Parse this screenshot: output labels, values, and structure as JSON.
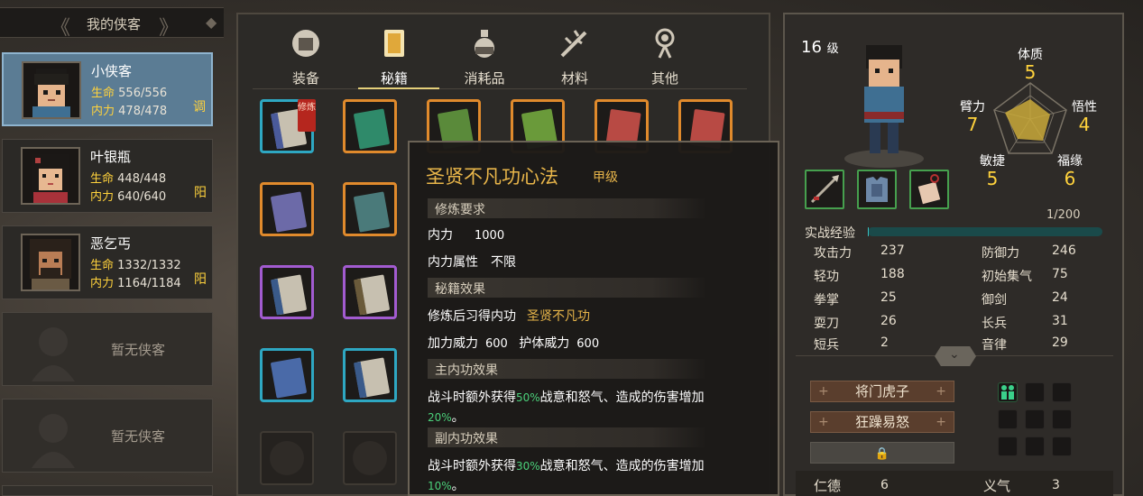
{
  "roster": {
    "title": "我的侠客",
    "characters": [
      {
        "name": "小侠客",
        "hp_label": "生命",
        "hp": "556/556",
        "mp_label": "内力",
        "mp": "478/478",
        "tag": "调"
      },
      {
        "name": "叶银瓶",
        "hp_label": "生命",
        "hp": "448/448",
        "mp_label": "内力",
        "mp": "640/640",
        "tag": "阳"
      },
      {
        "name": "恶乞丐",
        "hp_label": "生命",
        "hp": "1332/1332",
        "mp_label": "内力",
        "mp": "1164/1184",
        "tag": "阳"
      }
    ],
    "empty_slots": [
      "暂无侠客",
      "暂无侠客"
    ]
  },
  "tabs": [
    {
      "label": "装备",
      "icon": "armor-icon"
    },
    {
      "label": "秘籍",
      "icon": "book-icon"
    },
    {
      "label": "消耗品",
      "icon": "potion-icon"
    },
    {
      "label": "材料",
      "icon": "herb-icon"
    },
    {
      "label": "其他",
      "icon": "amulet-icon"
    }
  ],
  "active_tab": "秘籍",
  "slot_badge": "修炼",
  "tooltip": {
    "title": "圣贤不凡功心法",
    "grade": "甲级",
    "req_header": "修炼要求",
    "req_mp_label": "内力",
    "req_mp_value": "1000",
    "req_attr_label": "内力属性",
    "req_attr_value": "不限",
    "effect_header": "秘籍效果",
    "learn_label": "修炼后习得内功",
    "learn_value": "圣贤不凡功",
    "power_label": "加力威力",
    "power_value": "600",
    "guard_label": "护体威力",
    "guard_value": "600",
    "main_header": "主内功效果",
    "main_text_a": "战斗时额外获得",
    "main_pct": "50%",
    "main_text_b": "战意和怒气、造成的伤害增加",
    "main_dmg": "20%",
    "main_end": "。",
    "sub_header": "副内功效果",
    "sub_text_a": "战斗时额外获得",
    "sub_pct": "30%",
    "sub_text_b": "战意和怒气、造成的伤害增加",
    "sub_dmg": "10%",
    "sub_end": "。"
  },
  "hero": {
    "level": "16",
    "level_unit": "级",
    "attributes": {
      "tizhi": {
        "label": "体质",
        "value": "5"
      },
      "wuxing": {
        "label": "悟性",
        "value": "4"
      },
      "fuyuan": {
        "label": "福缘",
        "value": "6"
      },
      "minjie": {
        "label": "敏捷",
        "value": "5"
      },
      "bili": {
        "label": "臂力",
        "value": "7"
      }
    },
    "exp_label": "实战经验",
    "exp_value": "1/200",
    "exp_fraction": 0.005,
    "stats_left": [
      {
        "label": "攻击力",
        "value": "237"
      },
      {
        "label": "轻功",
        "value": "188"
      },
      {
        "label": "拳掌",
        "value": "25"
      },
      {
        "label": "耍刀",
        "value": "26"
      },
      {
        "label": "短兵",
        "value": "2"
      }
    ],
    "stats_right": [
      {
        "label": "防御力",
        "value": "246"
      },
      {
        "label": "初始集气",
        "value": "75"
      },
      {
        "label": "御剑",
        "value": "24"
      },
      {
        "label": "长兵",
        "value": "31"
      },
      {
        "label": "音律",
        "value": "29"
      }
    ],
    "traits": [
      "将门虎子",
      "狂躁易怒"
    ],
    "bottom": [
      {
        "label": "仁德",
        "value": "6"
      },
      {
        "label": "义气",
        "value": "3"
      }
    ]
  },
  "colors": {
    "accent_gold": "#e9b64a",
    "highlight_green": "#4bd07a",
    "yellow_label": "#ffd23c"
  }
}
